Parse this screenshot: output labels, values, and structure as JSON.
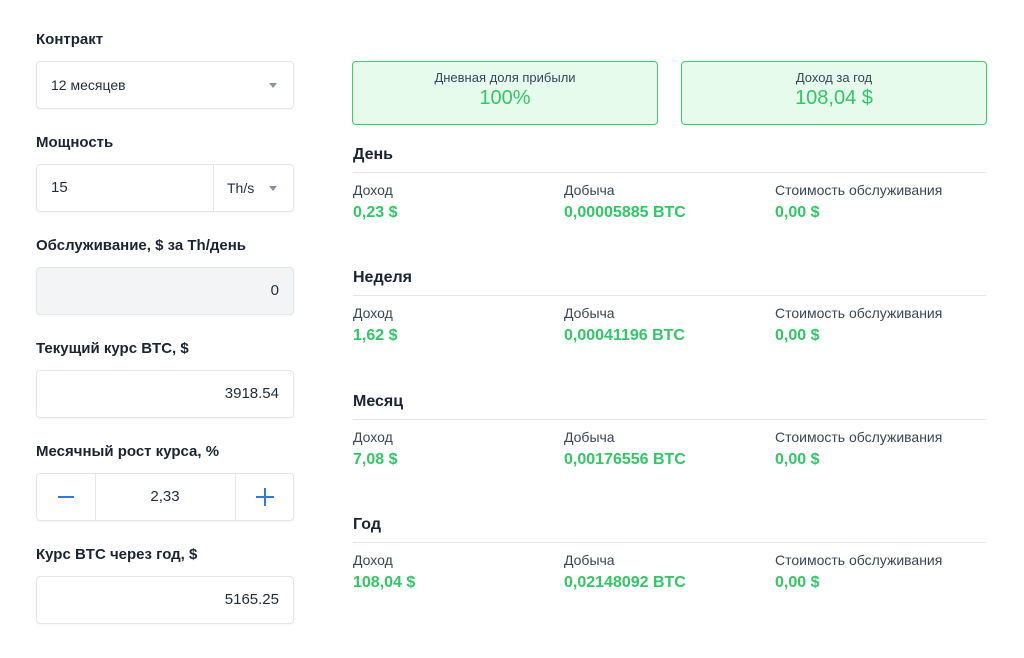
{
  "form": {
    "contract": {
      "label": "Контракт",
      "selected": "12 месяцев"
    },
    "power": {
      "label": "Мощность",
      "value": "15",
      "unit": "Th/s"
    },
    "maintenance": {
      "label": "Обслуживание, $ за Th/день",
      "value": "0"
    },
    "btc_rate": {
      "label": "Текущий курс BTC, $",
      "value": "3918.54"
    },
    "monthly_growth": {
      "label": "Месячный рост курса, %",
      "value": "2,33"
    },
    "btc_year": {
      "label": "Курс BTC через год, $",
      "value": "5165.25"
    }
  },
  "summary": {
    "daily_share": {
      "label": "Дневная доля прибыли",
      "value": "100%"
    },
    "yearly_income": {
      "label": "Доход за год",
      "value": "108,04 $"
    }
  },
  "columns": {
    "income": "Доход",
    "mining": "Добыча",
    "maintenance_cost": "Стоимость обслуживания"
  },
  "periods": [
    {
      "title": "День",
      "income": "0,23 $",
      "mining": "0,00005885 BTC",
      "maintenance": "0,00 $"
    },
    {
      "title": "Неделя",
      "income": "1,62 $",
      "mining": "0,00041196 BTC",
      "maintenance": "0,00 $"
    },
    {
      "title": "Месяц",
      "income": "7,08 $",
      "mining": "0,00176556 BTC",
      "maintenance": "0,00 $"
    },
    {
      "title": "Год",
      "income": "108,04 $",
      "mining": "0,02148092 BTC",
      "maintenance": "0,00 $"
    }
  ],
  "colors": {
    "accent_green": "#2fc964",
    "card_bg": "#e6fbec",
    "stepper_blue": "#2c7be5"
  }
}
